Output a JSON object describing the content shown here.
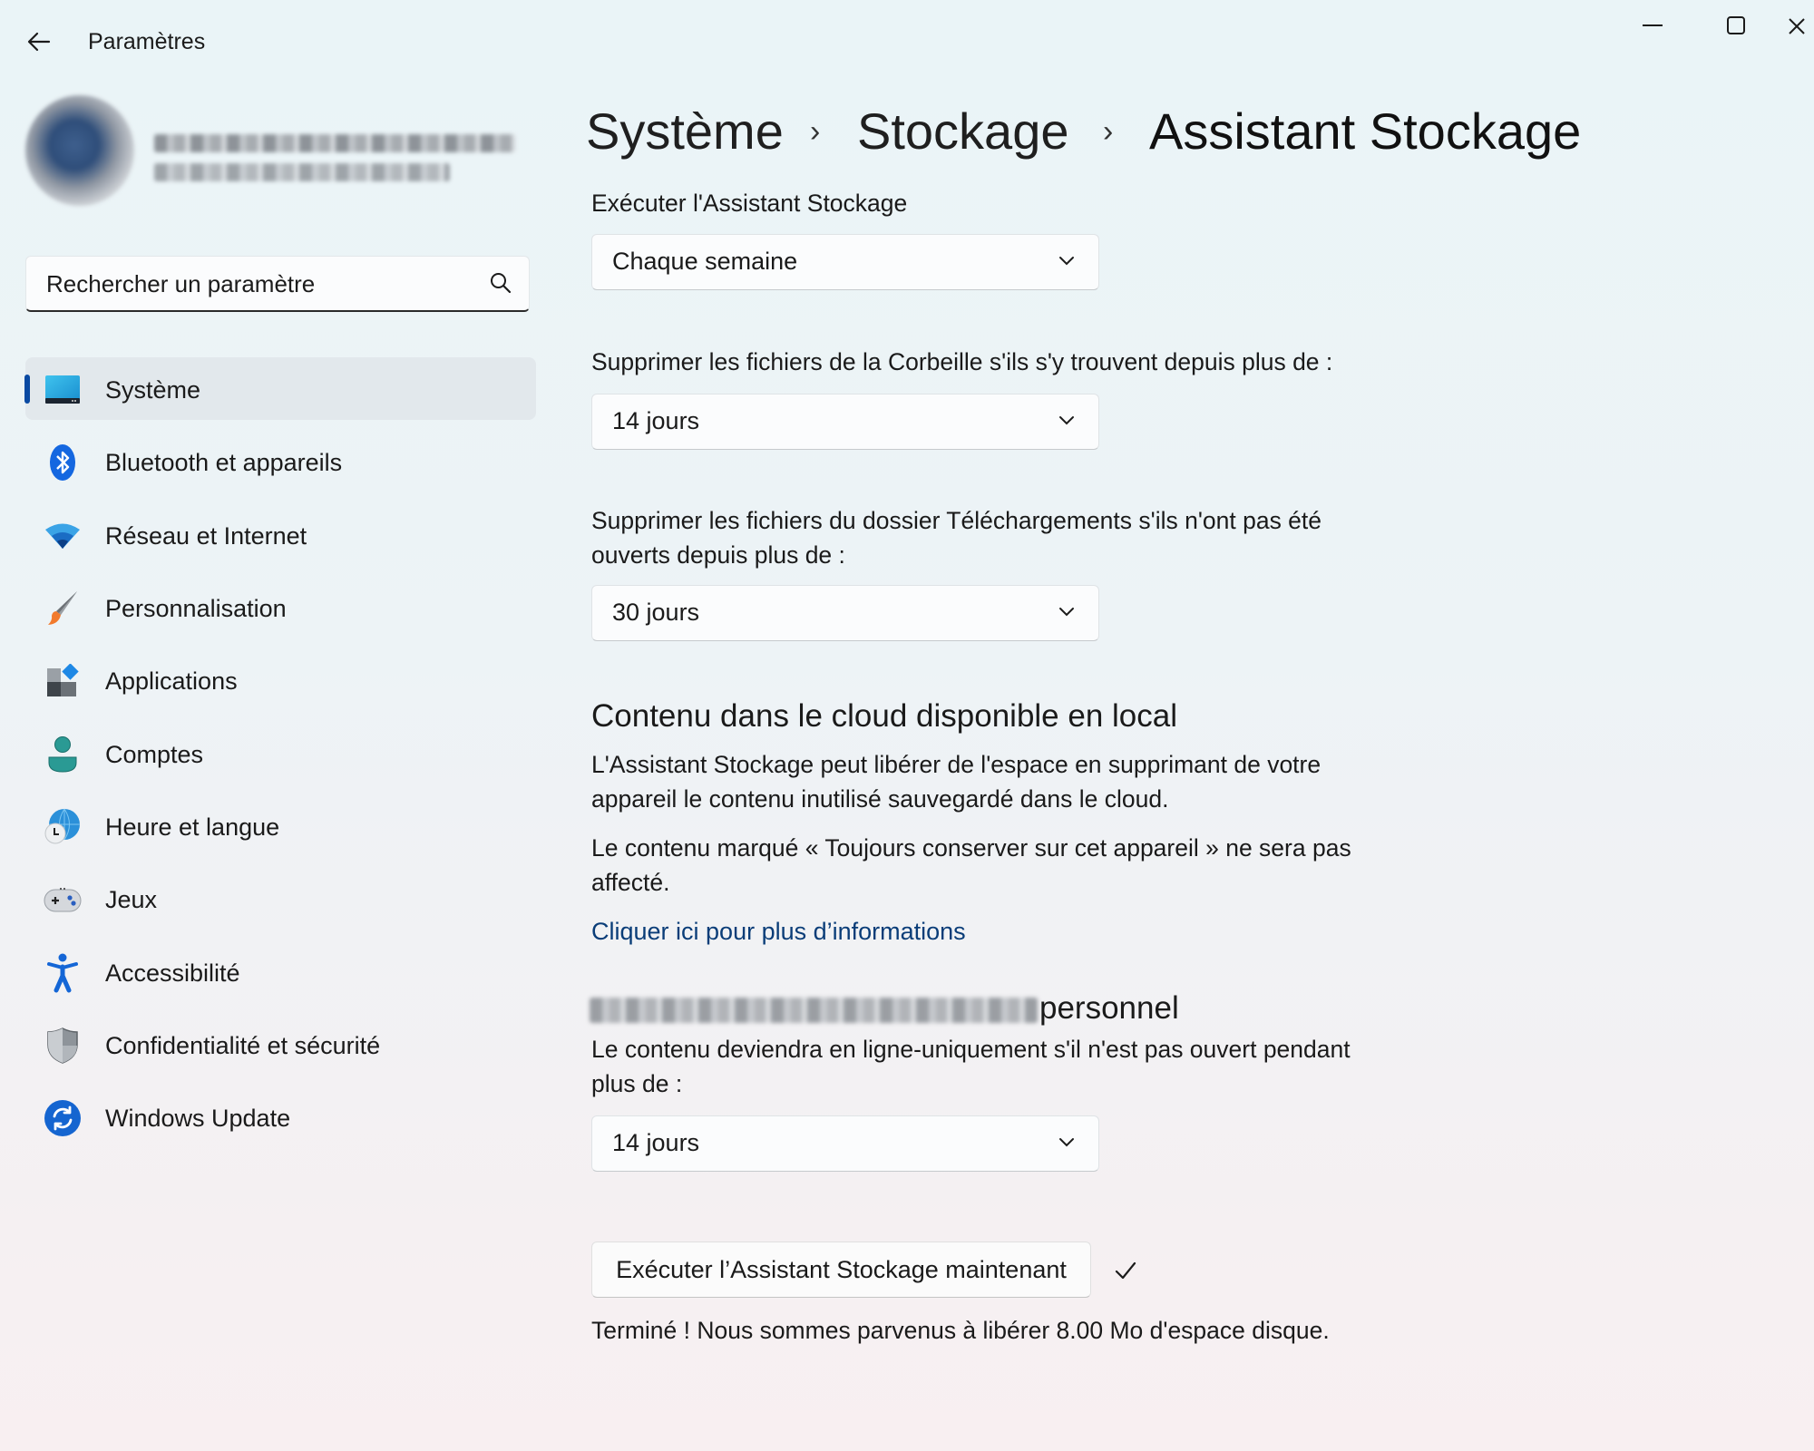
{
  "window": {
    "title": "Paramètres",
    "back_icon": "arrow-left-icon",
    "controls": [
      "minimize-icon",
      "maximize-icon",
      "close-icon"
    ]
  },
  "profile": {
    "name": "[blurred name]",
    "email": "[blurred email]"
  },
  "search": {
    "placeholder": "Rechercher un paramètre",
    "value": "",
    "icon": "search-icon"
  },
  "sidebar": {
    "selected_index": 0,
    "accent": "#0a4aa2",
    "items": [
      {
        "label": "Système",
        "icon": "monitor-icon"
      },
      {
        "label": "Bluetooth et appareils",
        "icon": "bluetooth-icon"
      },
      {
        "label": "Réseau et Internet",
        "icon": "wifi-icon"
      },
      {
        "label": "Personnalisation",
        "icon": "paintbrush-icon"
      },
      {
        "label": "Applications",
        "icon": "apps-icon"
      },
      {
        "label": "Comptes",
        "icon": "user-icon"
      },
      {
        "label": "Heure et langue",
        "icon": "globe-clock-icon"
      },
      {
        "label": "Jeux",
        "icon": "gamepad-icon"
      },
      {
        "label": "Accessibilité",
        "icon": "accessibility-icon"
      },
      {
        "label": "Confidentialité et sécurité",
        "icon": "shield-icon"
      },
      {
        "label": "Windows Update",
        "icon": "update-icon"
      }
    ]
  },
  "breadcrumb": {
    "items": [
      "Système",
      "Stockage",
      "Assistant Stockage"
    ],
    "separator": "›"
  },
  "settings": {
    "run_label": "Exécuter l'Assistant Stockage",
    "run_value": "Chaque semaine",
    "recycle_label": "Supprimer les fichiers de la Corbeille s'ils s'y trouvent depuis plus de :",
    "recycle_value": "14 jours",
    "downloads_label_line1": "Supprimer les fichiers du dossier Téléchargements s'ils n'ont pas été",
    "downloads_label_line2": "ouverts depuis plus de :",
    "downloads_value": "30 jours"
  },
  "cloud": {
    "heading": "Contenu dans le cloud disponible en local",
    "para1_line1": "L'Assistant Stockage peut libérer de l'espace en supprimant de votre",
    "para1_line2": "appareil le contenu inutilisé sauvegardé dans le cloud.",
    "para2_line1": "Le contenu marqué « Toujours conserver sur cet appareil » ne sera pas",
    "para2_line2": "affecté.",
    "link": "Cliquer ici pour plus d’informations",
    "account_heading_suffix": "personnel",
    "online_label_line1": "Le contenu deviendra en ligne-uniquement s'il n'est pas ouvert pendant",
    "online_label_line2": "plus de :",
    "online_value": "14 jours"
  },
  "run_now": {
    "button": "Exécuter l’Assistant Stockage maintenant",
    "status_icon": "checkmark-icon",
    "result": "Terminé ! Nous sommes parvenus à libérer 8.00 Mo d'espace disque."
  }
}
